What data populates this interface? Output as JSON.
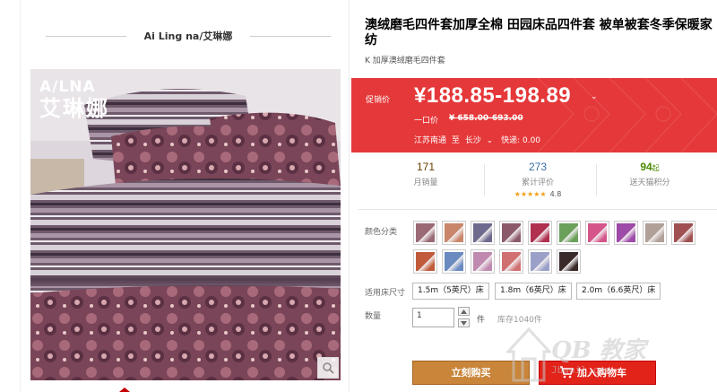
{
  "gallery": {
    "brand_name": "Ai Ling na/艾琳娜",
    "logo_en": "A/LNA",
    "logo_cn": "艾琳娜"
  },
  "product": {
    "title": "澳绒磨毛四件套加厚全棉 田园床品四件套 被单被套冬季保暖家纺",
    "subtitle": "K 加厚澳绒磨毛四件套"
  },
  "promo": {
    "promo_label": "促销价",
    "price": "¥188.85-198.89",
    "caret": "⌄",
    "orig_label": "一口价",
    "orig_price": "¥ 658.00-693.00",
    "ship_from": "江苏南通",
    "ship_to_word": "至",
    "ship_to": "长沙",
    "express": "快递: 0.00"
  },
  "stats": {
    "sales_num": "171",
    "sales_label": "月销量",
    "reviews_num": "273",
    "reviews_label": "累计评价",
    "stars": "★★★★★",
    "rating": "4.8",
    "points_num": "94",
    "points_unit": "起",
    "points_label": "送天猫积分"
  },
  "options": {
    "color_label": "颜色分类",
    "size_label": "适用床尺寸",
    "sizes": [
      "1.5m（5英尺）床",
      "1.8m（6英尺）床",
      "2.0m（6.6英尺）床"
    ],
    "qty_label": "数量",
    "qty_value": "1",
    "qty_unit": "件",
    "stock": "库存1040件",
    "swatch_colors": [
      "#9a6a74",
      "#c9866a",
      "#6e6a8e",
      "#8b5a6a",
      "#b03050",
      "#6aa05a",
      "#d4558a",
      "#9d4aa8",
      "#b0a098",
      "#a05050",
      "#c05a3a",
      "#6a8ac0",
      "#c08ab0",
      "#d07070",
      "#9aa0c8",
      "#3a2a2a"
    ]
  },
  "actions": {
    "buy_label": "立刻购买",
    "cart_label": "加入购物车"
  },
  "watermark": {
    "text": "QB 教家",
    "url": "Jbwoil.com"
  },
  "colors": {
    "promo_bg": "#e5383a",
    "buy_bg": "#c9853a",
    "cart_bg": "#e2231a"
  }
}
